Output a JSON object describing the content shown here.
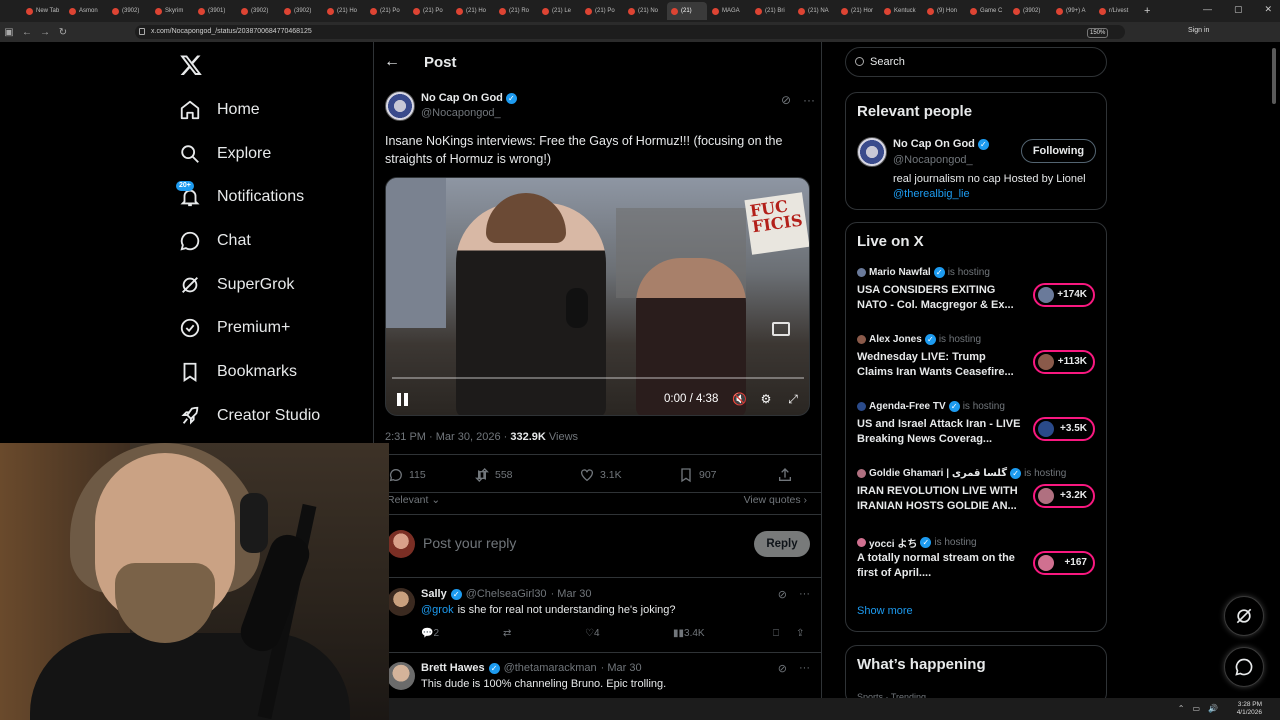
{
  "browser": {
    "tabs": [
      {
        "label": "New Tab"
      },
      {
        "label": "Asmon"
      },
      {
        "label": "(3902)"
      },
      {
        "label": "Skyrim"
      },
      {
        "label": "(3901)"
      },
      {
        "label": "(3902)"
      },
      {
        "label": "(3902)"
      },
      {
        "label": "(21) Ho"
      },
      {
        "label": "(21) Po"
      },
      {
        "label": "(21) Po"
      },
      {
        "label": "(21) Ho"
      },
      {
        "label": "(21) Ro"
      },
      {
        "label": "(21) Le"
      },
      {
        "label": "(21) Po"
      },
      {
        "label": "(21) No"
      },
      {
        "label": "(21)",
        "active": true
      },
      {
        "label": "MAGA"
      },
      {
        "label": "(21) Bri"
      },
      {
        "label": "(21) NA"
      },
      {
        "label": "(21) Hor"
      },
      {
        "label": "Kentuck"
      },
      {
        "label": "(9) Hon"
      },
      {
        "label": "Game C"
      },
      {
        "label": "(3902)"
      },
      {
        "label": "(99+) A"
      },
      {
        "label": "r/Livest"
      }
    ],
    "url": "x.com/Nocapongod_/status/2038700684770468125",
    "zoom": "150%",
    "signin": "Sign in"
  },
  "sidebar": {
    "items": [
      {
        "label": "Home",
        "icon": "home-icon"
      },
      {
        "label": "Explore",
        "icon": "search-icon"
      },
      {
        "label": "Notifications",
        "icon": "bell-icon",
        "badge": "20+"
      },
      {
        "label": "Chat",
        "icon": "chat-icon"
      },
      {
        "label": "SuperGrok",
        "icon": "grok-icon"
      },
      {
        "label": "Premium+",
        "icon": "verified-badge-icon"
      },
      {
        "label": "Bookmarks",
        "icon": "bookmark-icon"
      },
      {
        "label": "Creator Studio",
        "icon": "rocket-icon"
      }
    ]
  },
  "post": {
    "header_title": "Post",
    "author_name": "No Cap On God",
    "author_handle": "@Nocapongod_",
    "text": "Insane NoKings interviews: Free the Gays of Hormuz!!! (focusing on the straights of Hormuz is wrong!)",
    "video": {
      "time": "0:00 / 4:38",
      "sign_text": "FUC FICIS",
      "progress": 0.0
    },
    "timestamp": "2:31 PM · Mar 30, 2026 · ",
    "views_count": "332.9K",
    "views_label": " Views",
    "stats": {
      "replies": "115",
      "reposts": "558",
      "likes": "3.1K",
      "bookmarks": "907"
    },
    "sort_label": "Relevant",
    "view_quotes": "View quotes",
    "reply_placeholder": "Post your reply",
    "reply_button": "Reply"
  },
  "replies": [
    {
      "name": "Sally",
      "handle": "@ChelseaGirl30",
      "date": "· Mar 30",
      "mention": "@grok",
      "text": "is she for real not understanding he's joking?",
      "replies": "2",
      "reposts": "",
      "likes": "4",
      "views": "3.4K"
    },
    {
      "name": "Brett Hawes",
      "handle": "@thetamarackman",
      "date": "· Mar 30",
      "mention": "",
      "text": "This dude is 100% channeling Bruno. Epic trolling."
    }
  ],
  "right": {
    "search_placeholder": "Search",
    "relevant_people": {
      "title": "Relevant people",
      "name": "No Cap On God",
      "handle": "@Nocapongod_",
      "follow_label": "Following",
      "bio": "real journalism no cap Hosted by Lionel ",
      "bio_link": "@therealbig_lie"
    },
    "live": {
      "title": "Live on X",
      "items": [
        {
          "host": "Mario Nawfal",
          "status": "is hosting",
          "title": "USA CONSIDERS EXITING NATO - Col. Macgregor & Ex...",
          "count": "+174K"
        },
        {
          "host": "Alex Jones",
          "status": "is hosting",
          "title": "Wednesday LIVE: Trump Claims Iran Wants Ceasefire...",
          "count": "+113K"
        },
        {
          "host": "Agenda-Free TV",
          "status": "is hosting",
          "title": "US and Israel Attack Iran - LIVE Breaking News Coverag...",
          "count": "+3.5K"
        },
        {
          "host": "Goldie Ghamari | گلسا قمری",
          "status": "is hosting",
          "title": "IRAN REVOLUTION LIVE WITH IRANIAN HOSTS GOLDIE AN...",
          "count": "+3.2K"
        },
        {
          "host": "yocci よち",
          "status": "is hosting",
          "title": "A totally normal stream on the first of April....",
          "count": "+167"
        }
      ],
      "show_more": "Show more"
    },
    "whats_happening": "What’s happening",
    "happening_sub": "Sports · Trending"
  },
  "taskbar": {
    "time": "3:28 PM",
    "date": "4/1/2026"
  },
  "colors": {
    "accent": "#1d9bf0",
    "live_ring": "#f91880",
    "text_muted": "#71767b",
    "border": "#2f3336"
  }
}
